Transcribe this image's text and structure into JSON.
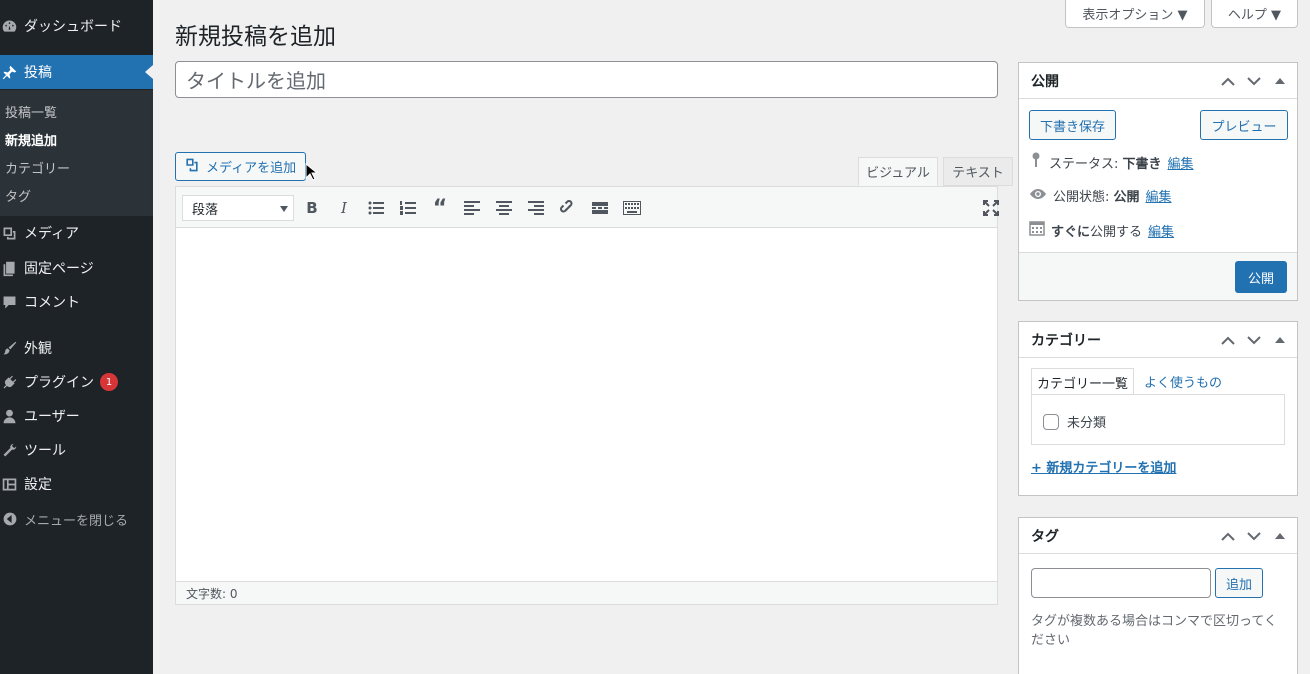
{
  "sidebar": {
    "items": [
      {
        "label": "ダッシュボード",
        "icon": "dashboard-icon"
      },
      {
        "label": "投稿",
        "icon": "pin-icon"
      },
      {
        "label": "メディア",
        "icon": "media-icon"
      },
      {
        "label": "固定ページ",
        "icon": "pages-icon"
      },
      {
        "label": "コメント",
        "icon": "comment-icon"
      },
      {
        "label": "外観",
        "icon": "brush-icon"
      },
      {
        "label": "プラグイン",
        "icon": "plugin-icon"
      },
      {
        "label": "ユーザー",
        "icon": "user-icon"
      },
      {
        "label": "ツール",
        "icon": "wrench-icon"
      },
      {
        "label": "設定",
        "icon": "settings-icon"
      },
      {
        "label": "メニューを閉じる",
        "icon": "collapse-icon"
      }
    ],
    "submenu": [
      "投稿一覧",
      "新規追加",
      "カテゴリー",
      "タグ"
    ],
    "plugin_badge": "1"
  },
  "screen_meta": {
    "options": "表示オプション ▼",
    "help": "ヘルプ ▼"
  },
  "page_title": "新規投稿を追加",
  "title_placeholder": "タイトルを追加",
  "media_button": "メディアを追加",
  "editor_tabs": {
    "visual": "ビジュアル",
    "text": "テキスト"
  },
  "format_select": "段落",
  "word_count": "文字数: 0",
  "publish": {
    "title": "公開",
    "save_draft": "下書き保存",
    "preview": "プレビュー",
    "status_label": "ステータス: ",
    "status_value": "下書き",
    "visibility_label": "公開状態: ",
    "visibility_value": "公開",
    "schedule_strong": "すぐに",
    "schedule_text": "公開する",
    "edit": "編集",
    "publish_button": "公開"
  },
  "categories": {
    "title": "カテゴリー",
    "tab_all": "カテゴリー一覧",
    "tab_popular": "よく使うもの",
    "item": "未分類",
    "add_new": "+ 新規カテゴリーを追加"
  },
  "tags": {
    "title": "タグ",
    "add_button": "追加",
    "hint": "タグが複数ある場合はコンマで区切ってください"
  }
}
